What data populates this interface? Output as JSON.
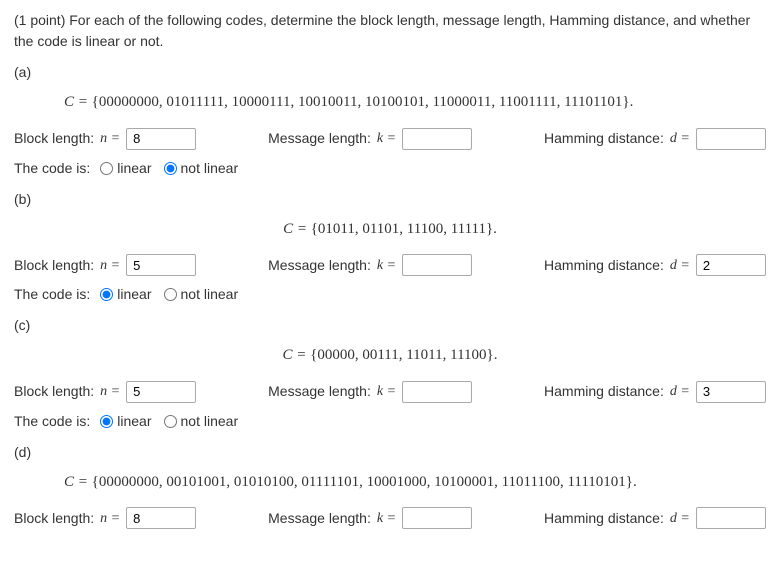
{
  "intro": "(1 point) For each of the following codes, determine the block length, message length, Hamming distance, and whether the code is linear or not.",
  "labels": {
    "block_length": "Block length:",
    "message_length": "Message length:",
    "hamming_distance": "Hamming distance:",
    "code_is": "The code is:",
    "linear": "linear",
    "not_linear": "not linear",
    "n_eq": "n =",
    "k_eq": "k =",
    "d_eq": "d =",
    "C_eq": "C ="
  },
  "parts": {
    "a": {
      "label": "(a)",
      "set": "{00000000, 01011111, 10000111, 10010011, 10100101, 11000011, 11001111, 11101101}.",
      "n": "8",
      "k": "",
      "d": "",
      "radio": "not_linear"
    },
    "b": {
      "label": "(b)",
      "set": "{01011, 01101, 11100, 11111}.",
      "n": "5",
      "k": "",
      "d": "2",
      "radio": "linear"
    },
    "c": {
      "label": "(c)",
      "set": "{00000, 00111, 11011, 11100}.",
      "n": "5",
      "k": "",
      "d": "3",
      "radio": "linear"
    },
    "d": {
      "label": "(d)",
      "set": "{00000000, 00101001, 01010100, 01111101, 10001000, 10100001, 11011100, 11110101}.",
      "n": "8",
      "k": "",
      "d": ""
    }
  }
}
